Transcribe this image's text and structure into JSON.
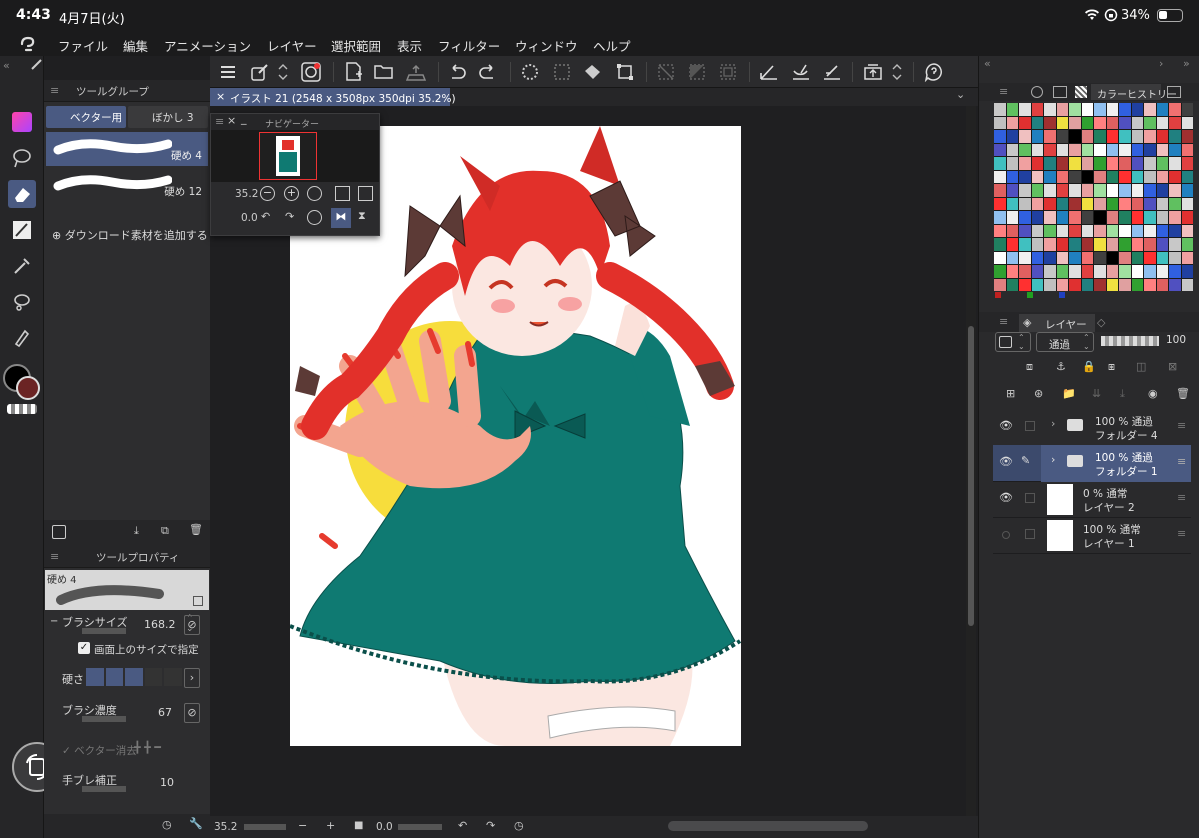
{
  "status": {
    "time": "4:43",
    "date": "4月7日(火)",
    "battery": "34%"
  },
  "menu": [
    "ファイル",
    "編集",
    "アニメーション",
    "レイヤー",
    "選択範囲",
    "表示",
    "フィルター",
    "ウィンドウ",
    "ヘルプ"
  ],
  "document": {
    "tab_title": "イラスト 21 (2548 x 3508px 350dpi 35.2%)"
  },
  "tool_group": {
    "header": "ツールグループ",
    "tab_vector": "ベクター用",
    "tab_blur": "ぼかし 3",
    "brushes": [
      {
        "name": "硬め 4"
      },
      {
        "name": "硬め 12"
      }
    ],
    "download_label": "ダウンロード素材を追加する"
  },
  "navigator": {
    "title": "ナビゲーター",
    "zoom": "35.2",
    "rotation": "0.0"
  },
  "tool_property": {
    "header": "ツールプロパティ",
    "preview_label": "硬め 4",
    "brush_size_label": "ブラシサイズ",
    "brush_size_value": "168.2",
    "canvas_size_label": "画面上のサイズで指定",
    "hardness_label": "硬さ",
    "brush_density_label": "ブラシ濃度",
    "brush_density_value": "67",
    "vector_erase_label": "ベクター消去",
    "stabilization_label": "手ブレ補正",
    "stabilization_value": "10"
  },
  "bottom": {
    "zoom": "35.2",
    "rotation": "0.0"
  },
  "color_history": {
    "header": "カラーヒストリー"
  },
  "layers": {
    "header": "レイヤー",
    "blend_mode": "通過",
    "opacity": "100",
    "rows": [
      {
        "mode": "100 % 通過",
        "name": "フォルダー 4",
        "type": "folder",
        "visible": true
      },
      {
        "mode": "100 % 通過",
        "name": "フォルダー 1",
        "type": "folder",
        "visible": true
      },
      {
        "mode": "0 % 通常",
        "name": "レイヤー 2",
        "type": "layer",
        "visible": true
      },
      {
        "mode": "100 % 通常",
        "name": "レイヤー 1",
        "type": "layer",
        "visible": false
      }
    ]
  },
  "colors": {
    "accent": "#4a5a82",
    "main_color": "#000000",
    "sub_color": "#6b2424"
  }
}
